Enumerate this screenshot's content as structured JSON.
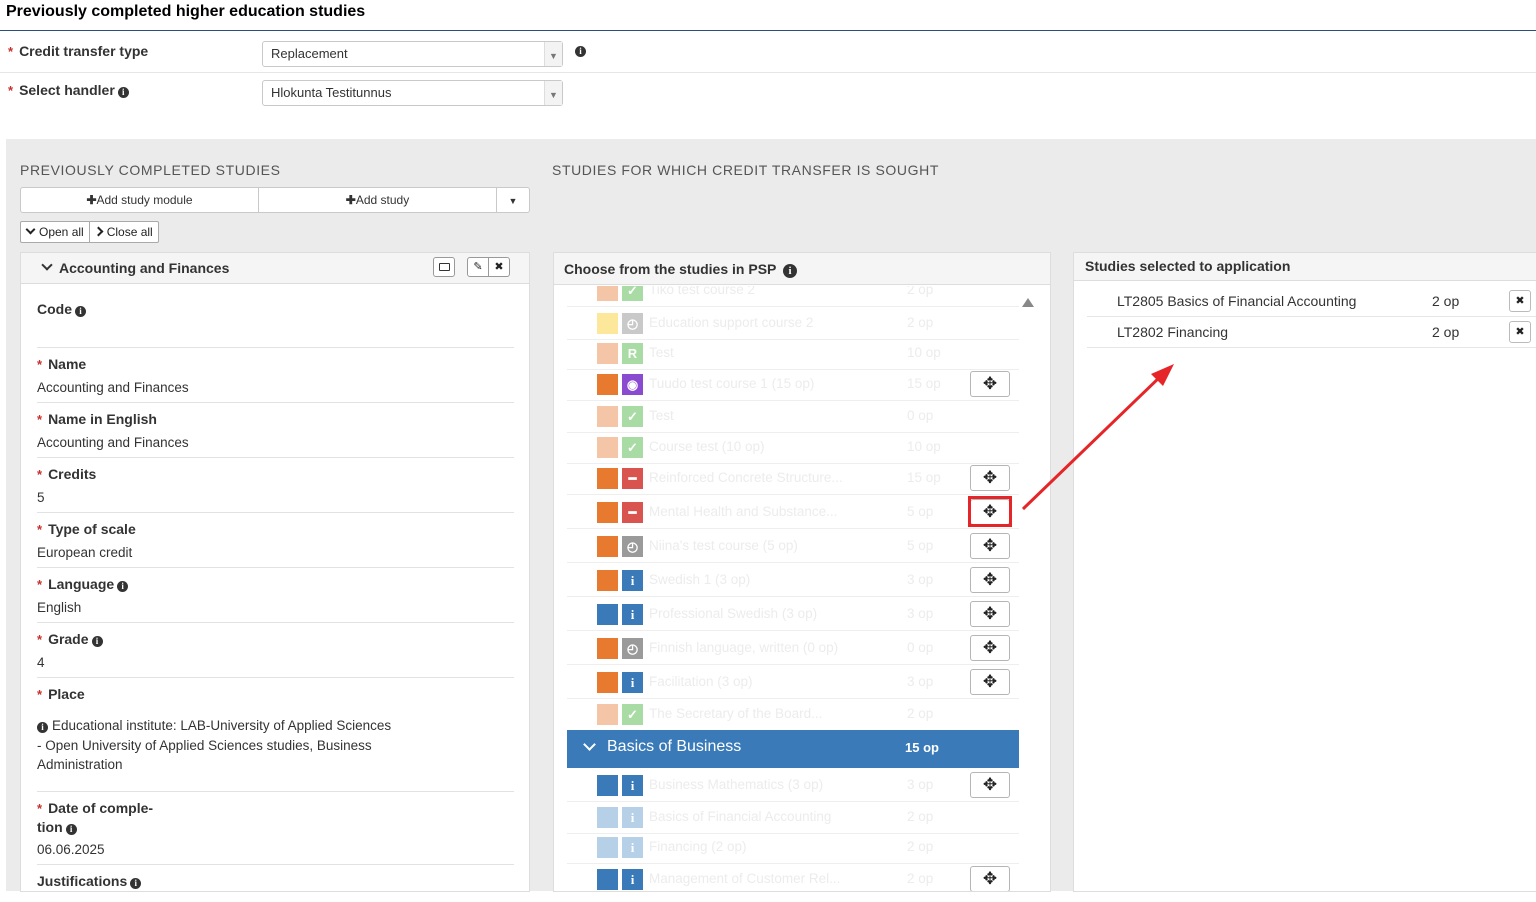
{
  "page": {
    "title": "Previously completed higher education studies"
  },
  "form": {
    "credit_transfer_type": {
      "label": "Credit transfer type",
      "value": "Replacement"
    },
    "select_handler": {
      "label": "Select handler",
      "value": "Hlokunta Testitunnus"
    }
  },
  "left_section": {
    "heading": "PREVIOUSLY COMPLETED STUDIES",
    "add_study_module": "Add study module",
    "add_study": "Add study",
    "open_all": "Open all",
    "close_all": "Close all",
    "module": {
      "title": "Accounting and Finances",
      "fields": {
        "code": {
          "label": "Code",
          "value": ""
        },
        "name": {
          "label": "Name",
          "value": "Accounting and Finances"
        },
        "name_en": {
          "label": "Name in English",
          "value": "Accounting and Finances"
        },
        "credits": {
          "label": "Credits",
          "value": "5"
        },
        "scale": {
          "label": "Type of scale",
          "value": "European credit"
        },
        "language": {
          "label": "Language",
          "value": "English"
        },
        "grade": {
          "label": "Grade",
          "value": "4"
        },
        "place": {
          "label": "Place",
          "line1": "Educational institute: LAB-University of Applied Sciences",
          "line2": "- Open University of Applied Sciences studies, Business",
          "line3": "Administration"
        },
        "date": {
          "label_line1": "Date of comple-",
          "label_line2": "tion",
          "value": "06.06.2025"
        },
        "justifications": {
          "label": "Justifications"
        }
      }
    }
  },
  "right_section": {
    "heading": "STUDIES FOR WHICH CREDIT TRANSFER IS SOUGHT",
    "psp_panel_title": "Choose from the studies in PSP",
    "psp_studies": [
      {
        "name": "Tiko test course 2",
        "op": "2 op",
        "sq": "#f5c5a8",
        "icon": "check",
        "icon_bg": "#a9dba5",
        "move": false
      },
      {
        "name": "Education support course 2",
        "op": "2 op",
        "sq": "#fde79a",
        "icon": "clock",
        "icon_bg": "#c9c9c9",
        "move": false
      },
      {
        "name": "Test",
        "op": "10 op",
        "sq": "#f5c5a8",
        "icon": "R",
        "icon_bg": "#a9dba5",
        "move": false
      },
      {
        "name": "Tuudo test course 1 (15 op)",
        "op": "15 op",
        "sq": "#e87a2f",
        "icon": "target",
        "icon_bg": "#8a4bd1",
        "move": true
      },
      {
        "name": "Test",
        "op": "0 op",
        "sq": "#f5c5a8",
        "icon": "check",
        "icon_bg": "#a9dba5",
        "move": false
      },
      {
        "name": "Course test (10 op)",
        "op": "10 op",
        "sq": "#f5c5a8",
        "icon": "check",
        "icon_bg": "#a9dba5",
        "move": false
      },
      {
        "name": "Reinforced Concrete Structure...",
        "op": "15 op",
        "sq": "#e87a2f",
        "icon": "minus",
        "icon_bg": "#d9534f",
        "move": true
      },
      {
        "name": "Mental Health and Substance...",
        "op": "5 op",
        "sq": "#e87a2f",
        "icon": "minus",
        "icon_bg": "#d9534f",
        "move": true,
        "highlight": true
      },
      {
        "name": "Niina's test course (5 op)",
        "op": "5 op",
        "sq": "#e87a2f",
        "icon": "clock",
        "icon_bg": "#9a9a9a",
        "move": true
      },
      {
        "name": "Swedish 1  (3 op)",
        "op": "3 op",
        "sq": "#e87a2f",
        "icon": "i",
        "icon_bg": "#3a7ab8",
        "move": true
      },
      {
        "name": "Professional Swedish (3 op)",
        "op": "3 op",
        "sq": "#3a7ab8",
        "icon": "i",
        "icon_bg": "#3a7ab8",
        "move": true
      },
      {
        "name": "Finnish language, written (0 op)",
        "op": "0 op",
        "sq": "#e87a2f",
        "icon": "clock",
        "icon_bg": "#9a9a9a",
        "move": true
      },
      {
        "name": "Facilitation (3 op)",
        "op": "3 op",
        "sq": "#e87a2f",
        "icon": "i",
        "icon_bg": "#3a7ab8",
        "move": true
      },
      {
        "name": "The Secretary of the Board...",
        "op": "2 op",
        "sq": "#f5c5a8",
        "icon": "check",
        "icon_bg": "#a9dba5",
        "move": false
      }
    ],
    "group": {
      "name": "Basics of Business",
      "op": "15 op"
    },
    "group_studies": [
      {
        "name": "Business Mathematics (3 op)",
        "op": "3 op",
        "sq": "#3a7ab8",
        "icon": "i",
        "icon_bg": "#3a7ab8",
        "move": true
      },
      {
        "name": "Basics of Financial Accounting",
        "op": "2 op",
        "sq": "#b6d0e8",
        "icon": "i",
        "icon_bg": "#b6d0e8",
        "move": false
      },
      {
        "name": "Financing (2 op)",
        "op": "2 op",
        "sq": "#b6d0e8",
        "icon": "i",
        "icon_bg": "#b6d0e8",
        "move": false
      },
      {
        "name": "Management of Customer Rel...",
        "op": "2 op",
        "sq": "#3a7ab8",
        "icon": "i",
        "icon_bg": "#3a7ab8",
        "move": true
      }
    ],
    "selected_panel_title": "Studies selected to application",
    "selected": [
      {
        "name": "LT2805 Basics of Financial Accounting",
        "op": "2 op"
      },
      {
        "name": "LT2802 Financing",
        "op": "2 op"
      }
    ]
  }
}
